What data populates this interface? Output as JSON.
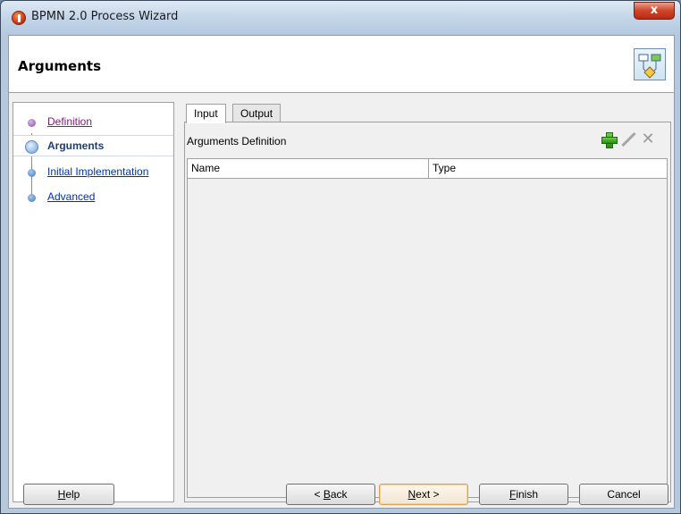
{
  "window": {
    "title": "BPMN 2.0 Process Wizard",
    "close_symbol": "x"
  },
  "header": {
    "title": "Arguments",
    "icon": "process-wizard-icon"
  },
  "steps": [
    {
      "label": "Definition",
      "state": "visited"
    },
    {
      "label": "Arguments",
      "state": "current"
    },
    {
      "label": "Initial Implementation",
      "state": "link"
    },
    {
      "label": "Advanced",
      "state": "link"
    }
  ],
  "tabs": [
    {
      "label": "Input",
      "active": true
    },
    {
      "label": "Output",
      "active": false
    }
  ],
  "section": {
    "title": "Arguments Definition"
  },
  "toolbar": {
    "add_icon": "plus-icon",
    "edit_icon": "pencil-icon",
    "delete_icon": "delete-icon"
  },
  "table": {
    "columns": [
      "Name",
      "Type"
    ],
    "rows": []
  },
  "footer": {
    "help": {
      "mnemonic": "H",
      "rest": "elp"
    },
    "back": {
      "prefix": "< ",
      "mnemonic": "B",
      "rest": "ack"
    },
    "next": {
      "mnemonic": "N",
      "rest": "ext >"
    },
    "finish": {
      "mnemonic": "F",
      "rest": "inish"
    },
    "cancel": "Cancel"
  }
}
